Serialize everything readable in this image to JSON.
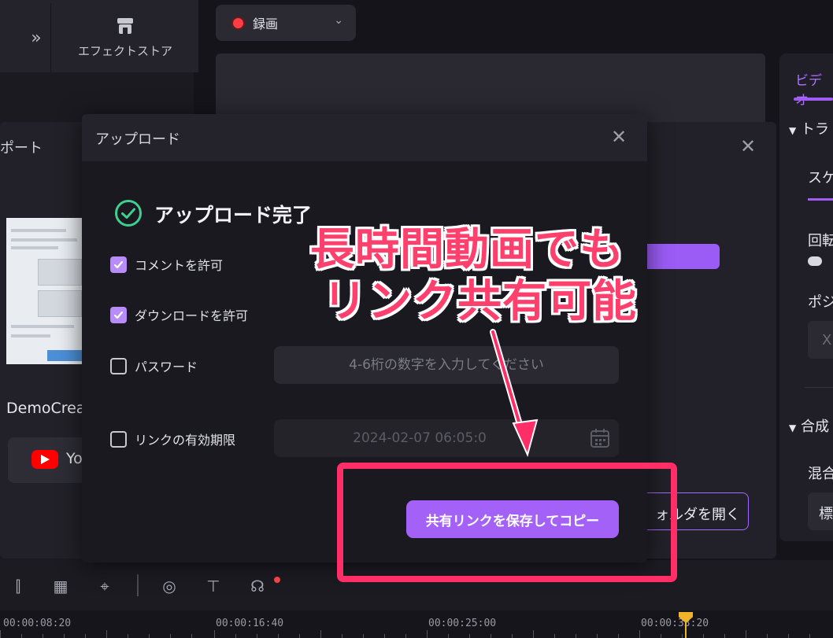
{
  "left_panel": {
    "expand_icon": "double-chevron-right-icon",
    "effect_store_icon": "store-icon",
    "effect_store_label": "エフェクトストア"
  },
  "record": {
    "label": "録画",
    "dot_color": "#ff3d44"
  },
  "right_panel": {
    "tab_label": "ビデオ",
    "section1": "トラ",
    "sub_tab": "スケ",
    "rotate_label": "回転",
    "position_label": "ポジ",
    "x_field": "X",
    "section2": "合成",
    "blend_label": "混合",
    "blend_value": "標"
  },
  "export_dialog": {
    "title": "ポート",
    "project_name": "DemoCrea",
    "youtube_label": "Yo",
    "open_folder_label": "ォルダを開く"
  },
  "upload_modal": {
    "title": "アップロード",
    "status": "アップロード完了",
    "options": [
      {
        "label": "コメントを許可",
        "checked": true
      },
      {
        "label": "ダウンロードを許可",
        "checked": true
      },
      {
        "label": "パスワード",
        "checked": false
      },
      {
        "label": "リンクの有効期限",
        "checked": false
      }
    ],
    "password_placeholder": "4-6桁の数字を入力してください",
    "expiry_value": "2024-02-07 06:05:0",
    "share_button": "共有リンクを保存してコピー",
    "accent_color": "#a461f7"
  },
  "annotation": {
    "line1": "長時間動画でも",
    "line2": "リンク共有可能",
    "color": "#ff3f6c"
  },
  "timeline": {
    "timecodes": [
      "00:00:08:20",
      "00:00:16:40",
      "00:00:25:00",
      "00:00:33:20"
    ],
    "playhead_color": "#f0b42b"
  }
}
